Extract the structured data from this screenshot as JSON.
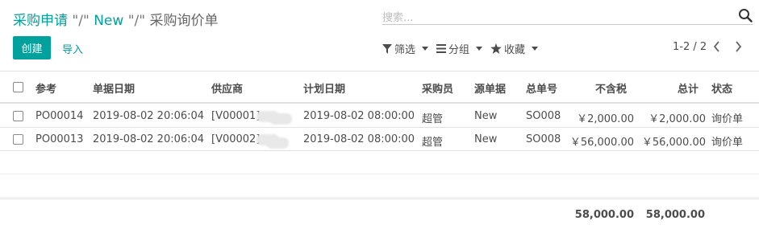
{
  "breadcrumb": {
    "root": "采购申请",
    "sep1": "\"/\"",
    "mid": "New",
    "sep2": "\"/\"",
    "current": "采购询价单"
  },
  "search": {
    "placeholder": "搜索..."
  },
  "toolbar": {
    "create_label": "创建",
    "import_label": "导入",
    "filter_label": "筛选",
    "group_label": "分组",
    "favorite_label": "收藏"
  },
  "pager": {
    "value": "1-2 / 2"
  },
  "table": {
    "headers": {
      "ref": "参考",
      "order_date": "单据日期",
      "vendor": "供应商",
      "planned_date": "计划日期",
      "buyer": "采购员",
      "source": "源单据",
      "origin_no": "总单号",
      "untaxed": "不含税",
      "total": "总计",
      "status": "状态"
    },
    "rows": [
      {
        "ref": "PO00014",
        "order_date": "2019-08-02 20:06:04",
        "vendor": "[V00001]",
        "planned_date": "2019-08-02 08:00:00",
        "buyer": "超管",
        "source": "New",
        "origin_no": "SO008",
        "untaxed": "￥2,000.00",
        "total": "￥2,000.00",
        "status": "询价单"
      },
      {
        "ref": "PO00013",
        "order_date": "2019-08-02 20:06:04",
        "vendor": "[V00002]",
        "planned_date": "2019-08-02 08:00:00",
        "buyer": "超管",
        "source": "New",
        "origin_no": "SO008",
        "untaxed": "￥56,000.00",
        "total": "￥56,000.00",
        "status": "询价单"
      }
    ],
    "footer": {
      "untaxed_sum": "58,000.00",
      "total_sum": "58,000.00"
    }
  },
  "colors": {
    "accent": "#00a09d",
    "border": "#dee2e6"
  }
}
